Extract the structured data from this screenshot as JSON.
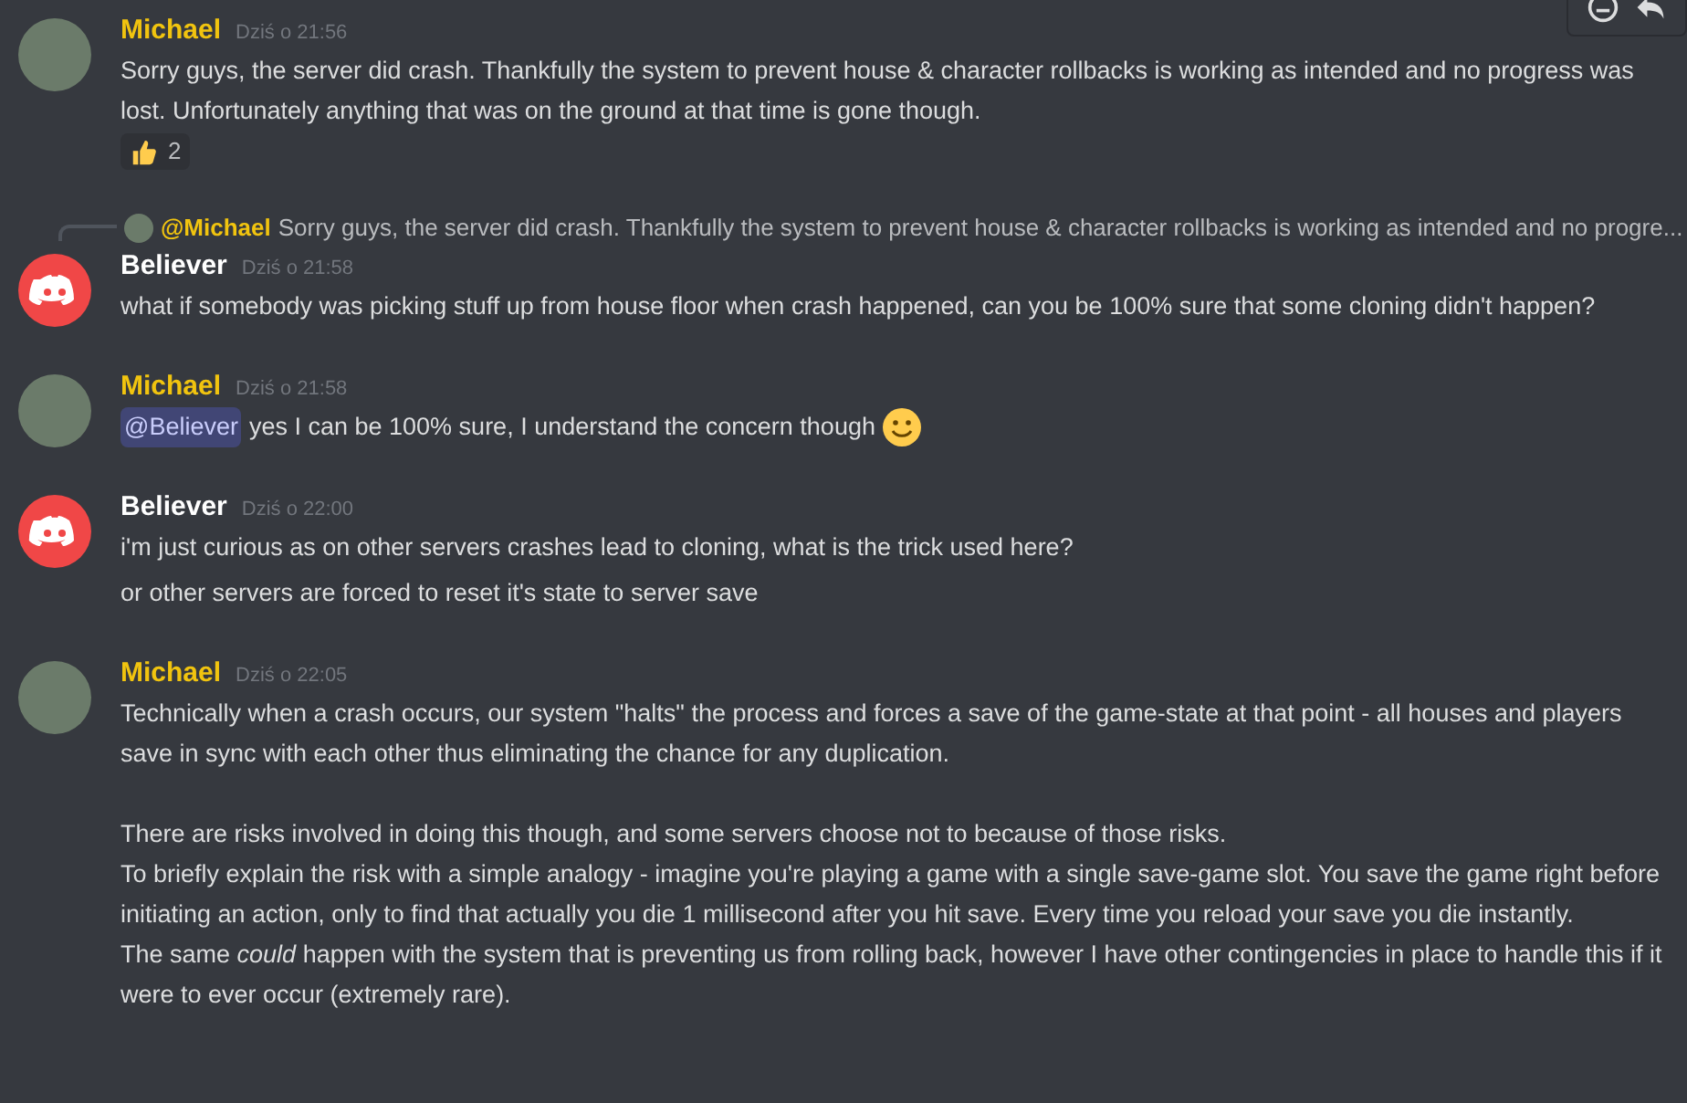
{
  "toolbar": {
    "buttons": [
      {
        "kind": "emoji"
      },
      {
        "kind": "reply"
      }
    ]
  },
  "messages": [
    {
      "kind": "photo",
      "author": "Michael",
      "color": "#f1c40f",
      "time": "Dziś o 21:56",
      "lines": [
        {
          "text": "Sorry guys, the server did crash. Thankfully the system to prevent house & character rollbacks is working as intended and no progress was lost. Unfortunately anything that was on the ground at that time is gone though."
        }
      ],
      "reactions": [
        {
          "kind": "thumbs-up",
          "count": "2"
        }
      ]
    },
    {
      "kind": "discord",
      "author": "Believer",
      "color": "#ffffff",
      "time": "Dziś o 21:58",
      "reply": {
        "author": "@Michael",
        "color": "#f1c40f",
        "text": "Sorry guys, the server did crash. Thankfully the system to prevent house & character rollbacks is working as intended and no progre..."
      },
      "lines": [
        {
          "text": "what if somebody was picking stuff up from house floor when crash happened, can you be 100% sure that some cloning didn't happen?"
        }
      ]
    },
    {
      "kind": "photo",
      "author": "Michael",
      "color": "#f1c40f",
      "time": "Dziś o 21:58",
      "lines": [
        {
          "mention": "@Believer",
          "text": "yes I can be 100% sure, I understand the concern though",
          "emoji": {
            "kind": "smile"
          }
        }
      ]
    },
    {
      "kind": "discord",
      "author": "Believer",
      "color": "#ffffff",
      "time": "Dziś o 22:00",
      "lines": [
        {
          "text": "i'm just curious as on other servers crashes lead to cloning, what is the trick used here?"
        },
        {
          "text": "or other servers are forced to reset it's state to server save"
        }
      ]
    },
    {
      "kind": "photo",
      "author": "Michael",
      "color": "#f1c40f",
      "time": "Dziś o 22:05",
      "paragraphs": [
        {
          "lines": [
            {
              "text": "Technically when a crash occurs, our system \"halts\" the process and forces a save of the game-state at that point - all houses and players save in sync with each other thus eliminating the chance for any duplication."
            }
          ]
        },
        {
          "lines": [
            {
              "text": "There are risks involved in doing this though, and some servers choose not to because of those risks."
            },
            {
              "text": "To briefly explain the risk with a simple analogy - imagine you're playing a game with a single save-game slot. You save the game right before initiating an action, only to find that actually you die 1 millisecond after you hit save. Every time you reload your save you die instantly."
            },
            {
              "text": "The same *could* happen with the system that is preventing us from rolling back, however I have other contingencies in place to handle this if it were to ever occur (extremely rare)."
            }
          ]
        }
      ]
    }
  ]
}
